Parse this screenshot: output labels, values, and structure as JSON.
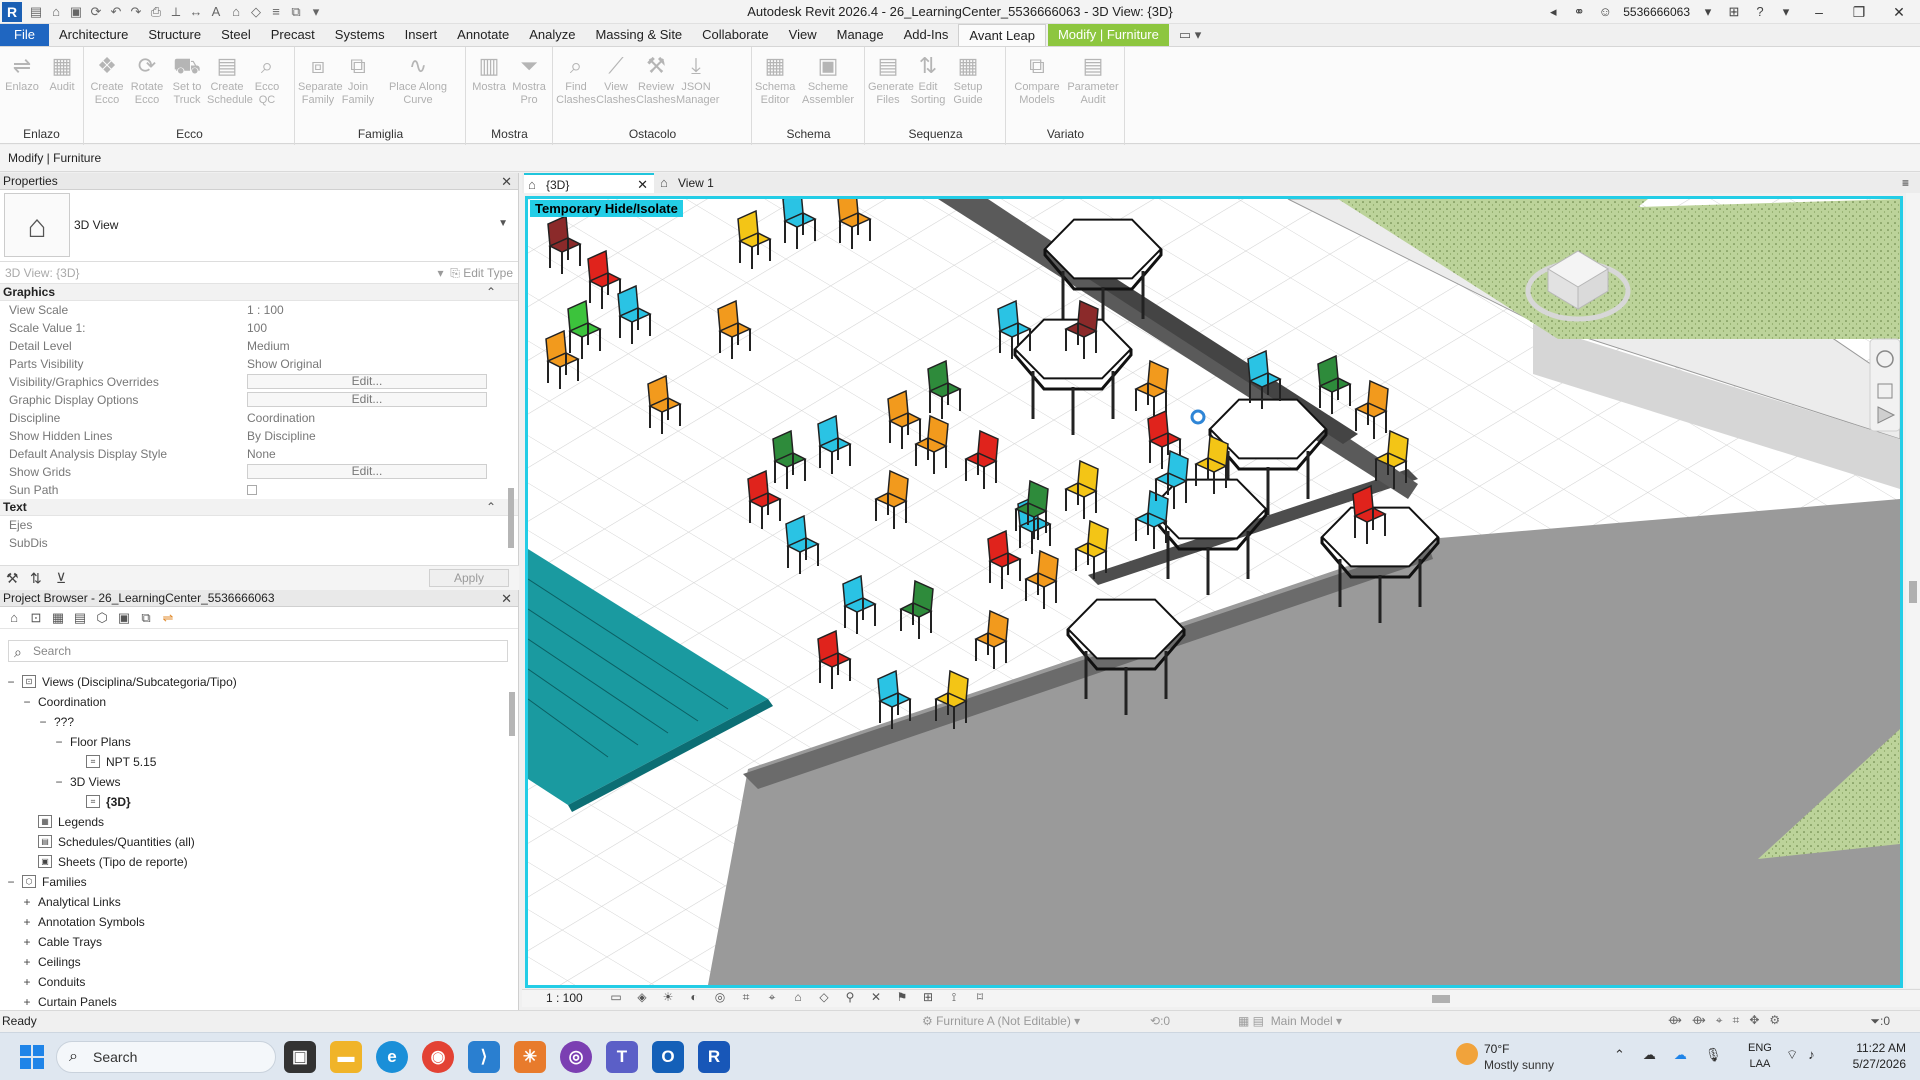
{
  "app": {
    "title": "Autodesk Revit 2026.4 - 26_LearningCenter_5536666063 - 3D View: {3D}",
    "user": "5536666063"
  },
  "ribbon": {
    "tabs": [
      {
        "label": "File"
      },
      {
        "label": "Architecture"
      },
      {
        "label": "Structure"
      },
      {
        "label": "Steel"
      },
      {
        "label": "Precast"
      },
      {
        "label": "Systems"
      },
      {
        "label": "Insert"
      },
      {
        "label": "Annotate"
      },
      {
        "label": "Analyze"
      },
      {
        "label": "Massing & Site"
      },
      {
        "label": "Collaborate"
      },
      {
        "label": "View"
      },
      {
        "label": "Manage"
      },
      {
        "label": "Add-Ins"
      },
      {
        "label": "Avant Leap"
      },
      {
        "label": "Modify | Furniture"
      }
    ],
    "panels": [
      {
        "title": "Enlazo",
        "tools": [
          "Enlazo",
          "Audit"
        ]
      },
      {
        "title": "Ecco",
        "tools": [
          "Create Ecco",
          "Rotate Ecco",
          "Set to Truck",
          "Create Schedule",
          "Ecco QC"
        ]
      },
      {
        "title": "Famiglia",
        "tools": [
          "Separate Family",
          "Join Family",
          "Place Along Curve"
        ]
      },
      {
        "title": "Mostra",
        "tools": [
          "Mostra",
          "Mostra Pro"
        ]
      },
      {
        "title": "Ostacolo",
        "tools": [
          "Find Clashes",
          "View Clashes",
          "Review Clashes",
          "JSON Manager"
        ]
      },
      {
        "title": "Schema",
        "tools": [
          "Schema Editor",
          "Scheme Assembler"
        ]
      },
      {
        "title": "Sequenza",
        "tools": [
          "Generate Files",
          "Edit Sorting",
          "Setup Guide"
        ]
      },
      {
        "title": "Variato",
        "tools": [
          "Compare Models",
          "Parameter Audit"
        ]
      }
    ]
  },
  "modify_bar": {
    "label": "Modify | Furniture"
  },
  "properties": {
    "header": "Properties",
    "type_name": "3D View",
    "instance_label": "3D View: {3D}",
    "edit_type": "Edit Type",
    "categories": [
      {
        "name": "Graphics",
        "rows": [
          {
            "name": "View Scale",
            "value": "1 : 100"
          },
          {
            "name": "Scale Value    1:",
            "value": "100"
          },
          {
            "name": "Detail Level",
            "value": "Medium"
          },
          {
            "name": "Parts Visibility",
            "value": "Show Original"
          },
          {
            "name": "Visibility/Graphics Overrides",
            "value": "Edit...",
            "button": true
          },
          {
            "name": "Graphic Display Options",
            "value": "Edit...",
            "button": true
          },
          {
            "name": "Discipline",
            "value": "Coordination"
          },
          {
            "name": "Show Hidden Lines",
            "value": "By Discipline"
          },
          {
            "name": "Default Analysis Display Style",
            "value": "None"
          },
          {
            "name": "Show Grids",
            "value": "Edit...",
            "button": true
          },
          {
            "name": "Sun Path",
            "value": "",
            "checkbox": true
          }
        ]
      },
      {
        "name": "Text",
        "rows": [
          {
            "name": "Ejes",
            "value": ""
          },
          {
            "name": "SubDis",
            "value": ""
          }
        ]
      }
    ],
    "apply_label": "Apply"
  },
  "project_browser": {
    "header": "Project Browser - 26_LearningCenter_5536666063",
    "search_placeholder": "Search",
    "tree": [
      {
        "label": "Views (Disciplina/Subcategoria/Tipo)",
        "toggle": "−",
        "level": 0,
        "icon": "views"
      },
      {
        "label": "Coordination",
        "toggle": "−",
        "level": 1
      },
      {
        "label": "???",
        "toggle": "−",
        "level": 2
      },
      {
        "label": "Floor Plans",
        "toggle": "−",
        "level": 3
      },
      {
        "label": "NPT 5.15",
        "toggle": "",
        "level": 4,
        "icon": "view"
      },
      {
        "label": "3D Views",
        "toggle": "−",
        "level": 3
      },
      {
        "label": "{3D}",
        "toggle": "",
        "level": 4,
        "icon": "view",
        "bold": true
      },
      {
        "label": "Legends",
        "toggle": "",
        "level": 1,
        "icon": "legend"
      },
      {
        "label": "Schedules/Quantities (all)",
        "toggle": "",
        "level": 1,
        "icon": "schedule"
      },
      {
        "label": "Sheets (Tipo de reporte)",
        "toggle": "",
        "level": 1,
        "icon": "sheet"
      },
      {
        "label": "Families",
        "toggle": "−",
        "level": 0,
        "icon": "family"
      },
      {
        "label": "Analytical Links",
        "toggle": "+",
        "level": 1
      },
      {
        "label": "Annotation Symbols",
        "toggle": "+",
        "level": 1
      },
      {
        "label": "Cable Trays",
        "toggle": "+",
        "level": 1
      },
      {
        "label": "Ceilings",
        "toggle": "+",
        "level": 1
      },
      {
        "label": "Conduits",
        "toggle": "+",
        "level": 1
      },
      {
        "label": "Curtain Panels",
        "toggle": "+",
        "level": 1
      }
    ]
  },
  "view_tabs": [
    {
      "label": "{3D}",
      "active": true
    },
    {
      "label": "View 1",
      "active": false
    }
  ],
  "viewport": {
    "banner": "Temporary Hide/Isolate",
    "scale": "1 : 100",
    "chair_colors": [
      "#2ac3e4",
      "#f29a1d",
      "#f3c516",
      "#e0231c",
      "#2e8b3b",
      "#8b2a2a",
      "#3cc33c"
    ]
  },
  "status_bar": {
    "ready": "Ready",
    "workset": "Furniture A (Not Editable)",
    "counter": ":0",
    "model": "Main Model",
    "filter": ":0"
  },
  "taskbar": {
    "search_placeholder": "Search",
    "temperature": "70°F",
    "weather": "Mostly sunny",
    "lang_top": "ENG",
    "lang_bottom": "LAA",
    "time": "11:22 AM",
    "date": "5/27/2026"
  }
}
